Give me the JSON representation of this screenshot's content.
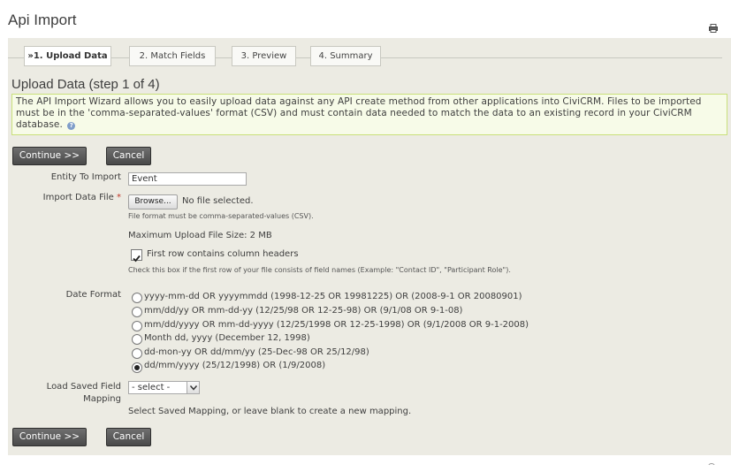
{
  "page": {
    "title": "Api Import"
  },
  "tabs": [
    {
      "label": "»1. Upload Data"
    },
    {
      "label": "2. Match Fields"
    },
    {
      "label": "3. Preview"
    },
    {
      "label": "4. Summary"
    }
  ],
  "step": {
    "heading": "Upload Data (step 1 of 4)",
    "help_text": "The API Import Wizard allows you to easily upload data against any API create method from other applications into CiviCRM. Files to be imported must be in the 'comma-separated-values' format (CSV) and must contain data needed to match the data to an existing record in your CiviCRM database.",
    "help_icon": "?"
  },
  "buttons": {
    "continue": "Continue >>",
    "cancel": "Cancel"
  },
  "form": {
    "entity_label": "Entity To Import",
    "entity_value": "Event",
    "file_label": "Import Data File",
    "required_mark": "*",
    "browse_label": "Browse...",
    "no_file_text": "No file selected.",
    "file_format_note": "File format must be comma-separated-values (CSV).",
    "max_size_text": "Maximum Upload File Size: 2 MB",
    "headers_checkbox_label": "First row contains column headers",
    "headers_checked": true,
    "headers_note": "Check this box if the first row of your file consists of field names (Example: \"Contact ID\", \"Participant Role\").",
    "date_format_label": "Date Format",
    "date_formats": [
      "yyyy-mm-dd OR yyyymmdd (1998-12-25 OR 19981225) OR (2008-9-1 OR 20080901)",
      "mm/dd/yy OR mm-dd-yy (12/25/98 OR 12-25-98) OR (9/1/08 OR 9-1-08)",
      "mm/dd/yyyy OR mm-dd-yyyy (12/25/1998 OR 12-25-1998) OR (9/1/2008 OR 9-1-2008)",
      "Month dd, yyyy (December 12, 1998)",
      "dd-mon-yy OR dd/mm/yy (25-Dec-98 OR 25/12/98)",
      "dd/mm/yyyy (25/12/1998) OR (1/9/2008)"
    ],
    "date_format_selected": 5,
    "saved_mapping_label_1": "Load Saved Field",
    "saved_mapping_label_2": "Mapping",
    "saved_mapping_value": "- select -",
    "saved_mapping_note": "Select Saved Mapping, or leave blank to create a new mapping."
  }
}
